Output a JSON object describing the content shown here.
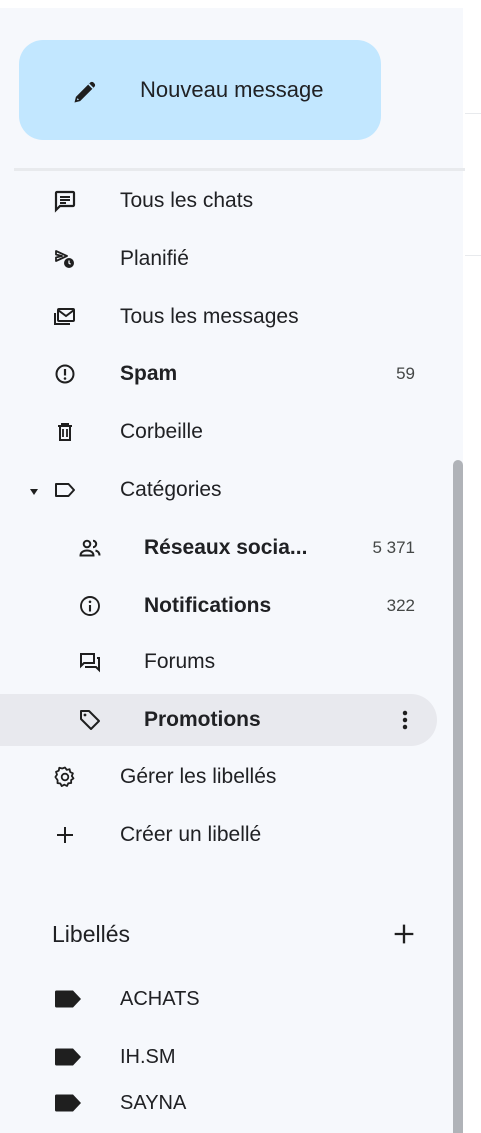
{
  "compose": {
    "label": "Nouveau message",
    "icon": "pencil-icon"
  },
  "nav": [
    {
      "id": "all-chats",
      "label": "Tous les chats",
      "icon": "chat-icon",
      "bold": false,
      "count": ""
    },
    {
      "id": "scheduled",
      "label": "Planifié",
      "icon": "scheduled-send-icon",
      "bold": false,
      "count": ""
    },
    {
      "id": "all-mail",
      "label": "Tous les messages",
      "icon": "all-mail-icon",
      "bold": false,
      "count": ""
    },
    {
      "id": "spam",
      "label": "Spam",
      "icon": "spam-icon",
      "bold": true,
      "count": "59"
    },
    {
      "id": "trash",
      "label": "Corbeille",
      "icon": "trash-icon",
      "bold": false,
      "count": ""
    },
    {
      "id": "categories",
      "label": "Catégories",
      "icon": "label-outline-icon",
      "bold": false,
      "count": ""
    },
    {
      "id": "social",
      "label": "Réseaux socia...",
      "icon": "people-icon",
      "bold": true,
      "count": "5 371"
    },
    {
      "id": "updates",
      "label": "Notifications",
      "icon": "info-icon",
      "bold": true,
      "count": "322"
    },
    {
      "id": "forums",
      "label": "Forums",
      "icon": "forum-icon",
      "bold": false,
      "count": ""
    },
    {
      "id": "promotions",
      "label": "Promotions",
      "icon": "tag-icon",
      "bold": true,
      "count": ""
    },
    {
      "id": "manage-labels",
      "label": "Gérer les libellés",
      "icon": "gear-icon",
      "bold": false,
      "count": ""
    },
    {
      "id": "create-label",
      "label": "Créer un libellé",
      "icon": "plus-icon",
      "bold": false,
      "count": ""
    }
  ],
  "labels": {
    "title": "Libellés",
    "items": [
      {
        "label": "ACHATS",
        "icon": "label-filled-icon"
      },
      {
        "label": "IH.SM",
        "icon": "label-filled-icon"
      },
      {
        "label": "SAYNA",
        "icon": "label-filled-icon"
      }
    ]
  },
  "colors": {
    "compose_bg": "#c2e7ff",
    "sidebar_bg": "#f6f8fc",
    "active_bg": "#e8e9ee",
    "text": "#202124",
    "icon": "#444746"
  }
}
